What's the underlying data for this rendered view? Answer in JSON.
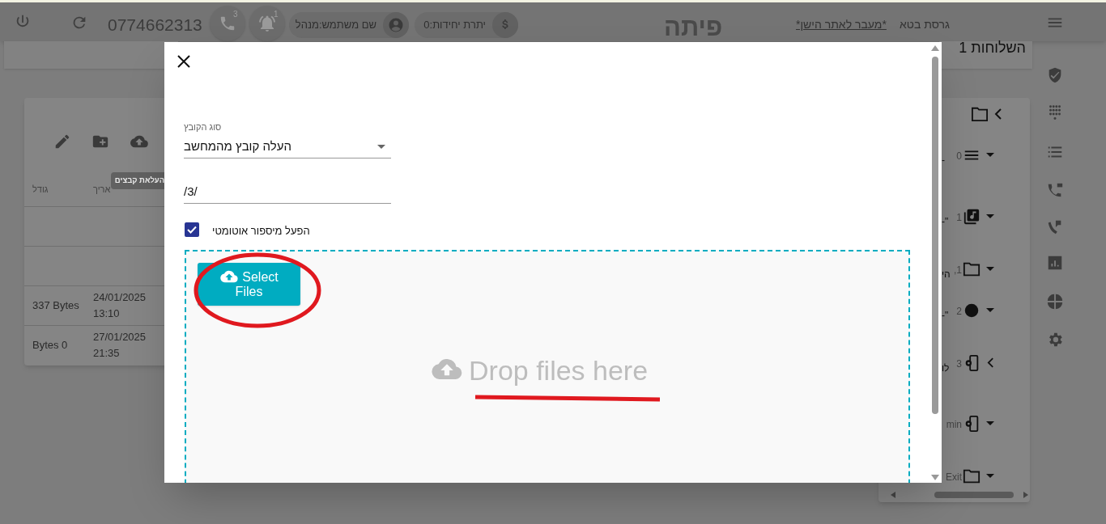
{
  "header": {
    "version": "גרסת בטא",
    "old_site_link": "*מעבר לאתר הישן*",
    "title": "פיתה",
    "units_chip": "יתרת יחידות:0",
    "user_chip": "שם משתמש:מנהל",
    "alerts_badge": "1",
    "calls_badge": "3",
    "phone_number": "0774662313"
  },
  "top_card_right": "השלוחות 1",
  "file_table": {
    "tooltip": "העלאת קבצים",
    "columns": [
      "אריך",
      "גודל"
    ],
    "rows": [
      {
        "size": "",
        "date": ""
      },
      {
        "size": "",
        "date": ""
      },
      {
        "size": "337 Bytes",
        "date": "24/01/2025 13:10"
      },
      {
        "size": "Bytes 0",
        "date": "27/01/2025 21:35"
      }
    ]
  },
  "tree_panel": {
    "items": [
      {
        "kind": "list",
        "number": "0",
        "side": "-",
        "expanded": false
      },
      {
        "kind": "music",
        "number": "1",
        "side": "\"-",
        "expanded": false
      },
      {
        "kind": "folder",
        "number": ",1",
        "side": "הי",
        "expanded": false
      },
      {
        "kind": "dot",
        "number": "2",
        "side": "\"-",
        "expanded": false
      },
      {
        "kind": "settings",
        "number": "3",
        "side": "לו",
        "expanded": true
      },
      {
        "kind": "settings",
        "number": "min",
        "expanded": false
      },
      {
        "kind": "folder",
        "number": "Exit",
        "expanded": false
      }
    ]
  },
  "dialog": {
    "file_type_label": "סוג הקובץ",
    "file_type_value": "העלה קובץ מהמחשב",
    "path_value": "/3/",
    "auto_numbering": {
      "label": "הפעל מיספור אוטומטי",
      "checked": true
    },
    "select_button": "Select Files",
    "drop_text": "Drop files here"
  }
}
